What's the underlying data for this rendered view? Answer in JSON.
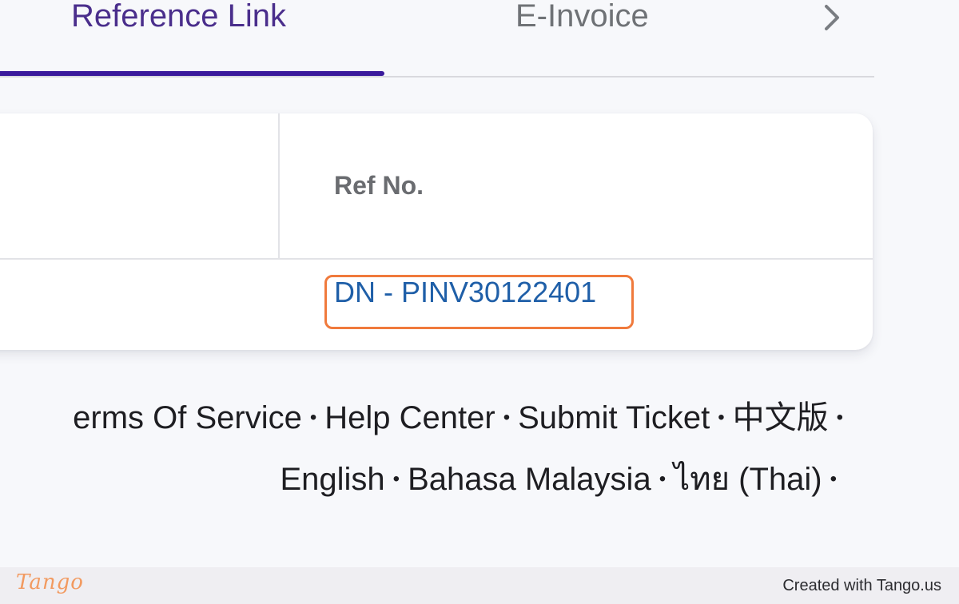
{
  "tabs": {
    "items": [
      {
        "label": "Reference Link",
        "active": true
      },
      {
        "label": "E-Invoice",
        "active": false
      }
    ],
    "next_icon": "chevron-right-icon",
    "active_color": "#3a1a9c"
  },
  "table": {
    "column_header": "Ref No.",
    "rows": [
      {
        "ref_no": "DN - PINV30122401"
      }
    ]
  },
  "highlight": {
    "color": "#f07a3c"
  },
  "footer": {
    "separator": "•",
    "line1": [
      "erms Of Service",
      "Help Center",
      "Submit Ticket",
      "中文版"
    ],
    "line2": [
      "English",
      "Bahasa Malaysia",
      "ไทย (Thai)"
    ]
  },
  "tango": {
    "logo": "Tango",
    "credit": "Created with Tango.us"
  }
}
